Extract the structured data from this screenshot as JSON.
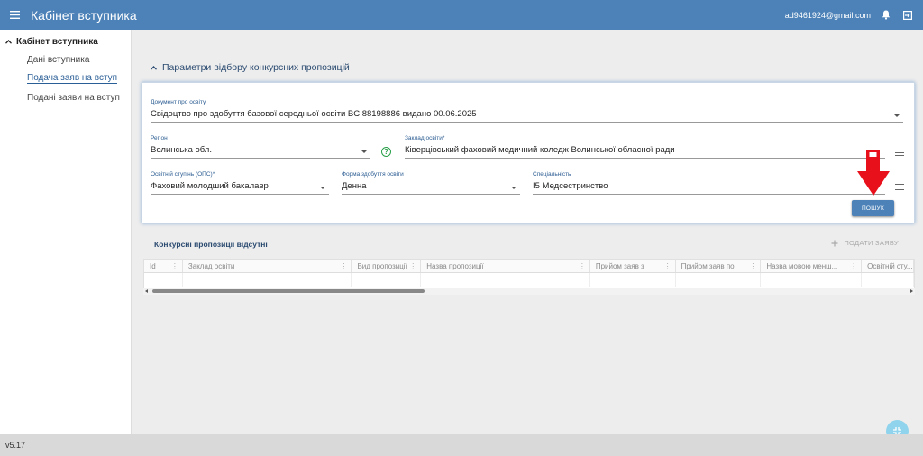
{
  "header": {
    "title": "Кабінет вступника",
    "email": "ad9461924@gmail.com"
  },
  "sidebar": {
    "section": "Кабінет вступника",
    "items": [
      {
        "label": "Дані вступника"
      },
      {
        "label": "Подача заяв на вступ"
      },
      {
        "label": "Подані заяви на вступ"
      }
    ]
  },
  "filters": {
    "title": "Параметри відбору конкурсних пропозицій",
    "document": {
      "label": "Документ про освіту",
      "value": "Свідоцтво про здобуття базової середньої освіти BC 88198886 видано 00.06.2025"
    },
    "region": {
      "label": "Регіон",
      "value": "Волинська обл."
    },
    "institution": {
      "label": "Заклад освіти*",
      "value": "Ківерцівський фаховий медичний коледж Волинської обласної ради"
    },
    "degree": {
      "label": "Освітній ступінь (ОПС)*",
      "value": "Фаховий молодший бакалавр"
    },
    "form": {
      "label": "Форма здобуття освіти",
      "value": "Денна"
    },
    "specialty": {
      "label": "Спеціальність",
      "value": "I5 Медсестринство"
    },
    "search_label": "ПОШУК"
  },
  "results": {
    "title": "Конкурсні пропозиції відсутні",
    "apply_label": "ПОДАТИ ЗАЯВУ",
    "columns": [
      "Id",
      "Заклад освіти",
      "Вид пропозиції",
      "Назва пропозиції",
      "Прийом заяв з",
      "Прийом заяв по",
      "Назва мовою менш...",
      "Освітній сту..."
    ]
  },
  "footer": {
    "version": "v5.17"
  },
  "colors": {
    "primary": "#4d82b8",
    "annotation_arrow": "#e8101a",
    "help": "#2aa04a"
  }
}
